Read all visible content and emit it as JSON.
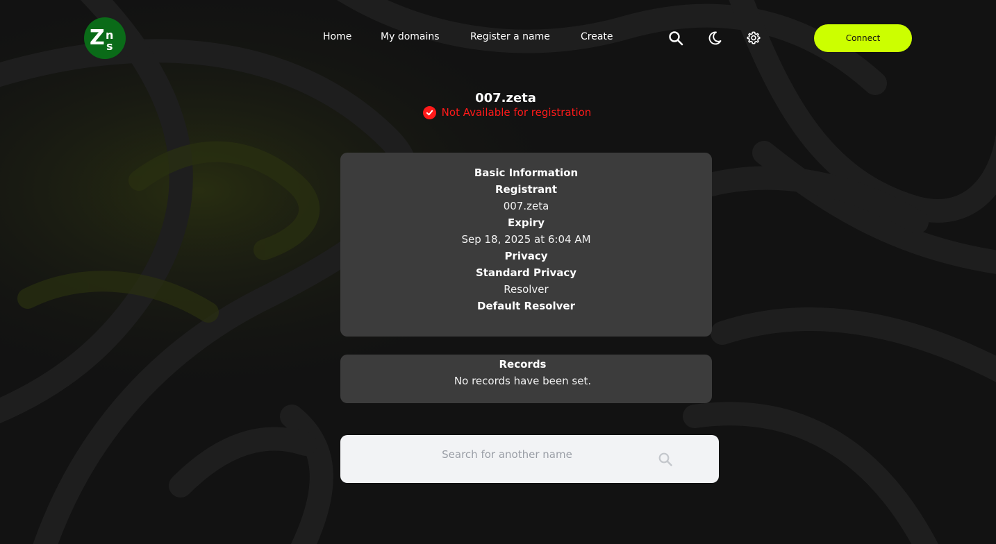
{
  "brand": {
    "logo_text_z": "Z",
    "logo_text_n": "n",
    "logo_text_s": "s",
    "logo_bg": "#0a6b18"
  },
  "nav": {
    "items": [
      {
        "label": "Home"
      },
      {
        "label": "My domains"
      },
      {
        "label": "Register a name"
      },
      {
        "label": "Create"
      }
    ]
  },
  "header_icons": [
    "search-icon",
    "moon-icon",
    "gear-icon"
  ],
  "connect_label": "Connect",
  "domain": {
    "name": "007.zeta",
    "status_text": "Not Available for registration",
    "status_color": "#ff1a1a"
  },
  "basic_info": {
    "heading": "Basic Information",
    "registrant_label": "Registrant",
    "registrant_value": "007.zeta",
    "expiry_label": "Expiry",
    "expiry_value": "Sep 18, 2025 at 6:04 AM",
    "privacy_label": "Privacy",
    "privacy_value": "Standard Privacy",
    "resolver_label": "Resolver",
    "resolver_value": "Default Resolver"
  },
  "records": {
    "heading": "Records",
    "empty_text": "No records have been set."
  },
  "search": {
    "placeholder": "Search for another name",
    "value": ""
  },
  "colors": {
    "accent": "#ccff00",
    "background": "#121212",
    "card": "#3c3c3c"
  }
}
